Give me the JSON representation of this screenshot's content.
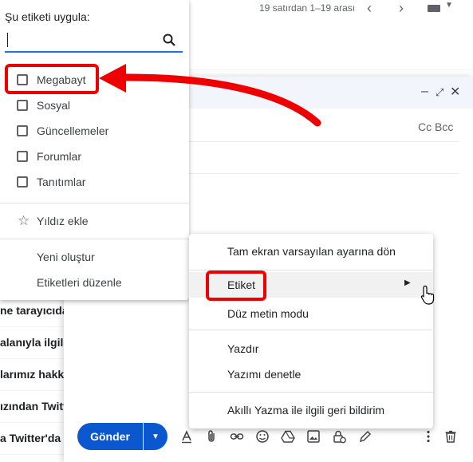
{
  "list": {
    "page_count": "19 satırdan 1–19 arası",
    "rows": [
      "ne tarayıcıda",
      "alanıyla ilgil",
      "larımız hakk",
      "ızından Twitt",
      "a Twitter'da I"
    ]
  },
  "compose": {
    "cc_bcc": "Cc Bcc",
    "send_label": "Gönder"
  },
  "label_menu": {
    "title": "Şu etiketi uygula:",
    "search_value": "",
    "labels": [
      "Megabayt",
      "Sosyal",
      "Güncellemeler",
      "Forumlar",
      "Tanıtımlar"
    ],
    "star_action": "Yıldız ekle",
    "create_new": "Yeni oluştur",
    "edit_labels": "Etiketleri düzenle"
  },
  "context_menu": {
    "items": [
      "Tam ekran varsayılan ayarına dön",
      "Etiket",
      "Düz metin modu",
      "Yazdır",
      "Yazımı denetle",
      "Akıllı Yazma ile ilgili geri bildirim"
    ]
  },
  "colors": {
    "highlight": "#ef0000",
    "send": "#0b57d0"
  }
}
